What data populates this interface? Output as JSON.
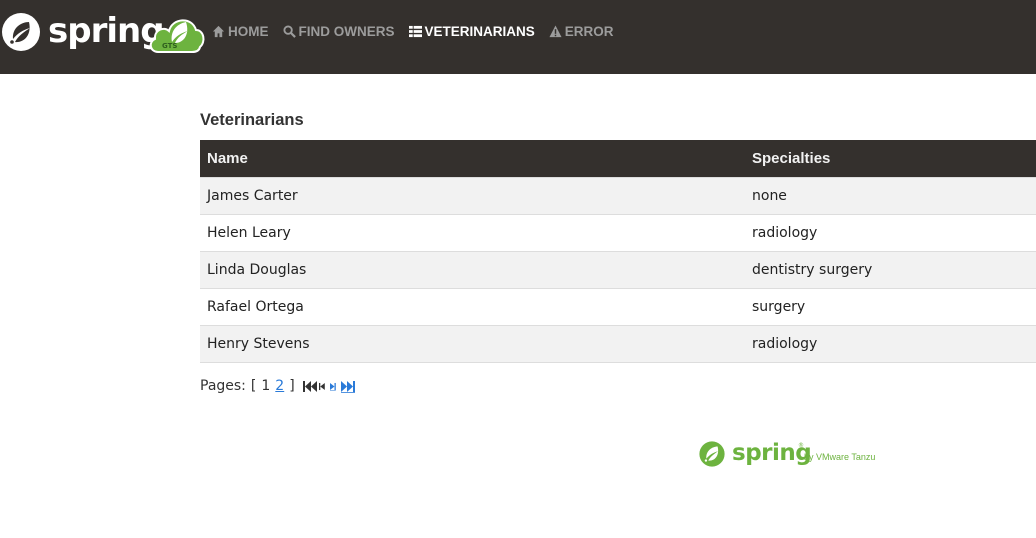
{
  "navbar": {
    "brand_word": "spring",
    "badge_text": "GTS",
    "items": [
      {
        "label": "HOME",
        "icon": "home-icon",
        "active": false
      },
      {
        "label": "FIND OWNERS",
        "icon": "search-icon",
        "active": false
      },
      {
        "label": "VETERINARIANS",
        "icon": "th-list-icon",
        "active": true
      },
      {
        "label": "ERROR",
        "icon": "warning-icon",
        "active": false
      }
    ]
  },
  "main": {
    "title": "Veterinarians",
    "table": {
      "columns": [
        "Name",
        "Specialties"
      ],
      "rows": [
        {
          "name": "James Carter",
          "specialties": "none"
        },
        {
          "name": "Helen Leary",
          "specialties": "radiology"
        },
        {
          "name": "Linda Douglas",
          "specialties": "dentistry surgery"
        },
        {
          "name": "Rafael Ortega",
          "specialties": "surgery"
        },
        {
          "name": "Henry Stevens",
          "specialties": "radiology"
        }
      ]
    },
    "pagination": {
      "label": "Pages:",
      "open_bracket": "[",
      "current_page": "1",
      "next_page": "2",
      "close_bracket": "]",
      "controls": [
        "first-page-icon",
        "previous-page-icon",
        "next-page-icon",
        "last-page-icon"
      ]
    }
  },
  "footer": {
    "brand_word": "spring",
    "trademark": "®",
    "tagline": "by VMware Tanzu"
  },
  "colors": {
    "navbar_bg": "#34302d",
    "nav_inactive": "#9c9c9c",
    "nav_active": "#ffffff",
    "spring_green": "#6db33f",
    "link_blue": "#2a7ad8",
    "row_stripe": "#f2f2f2"
  }
}
